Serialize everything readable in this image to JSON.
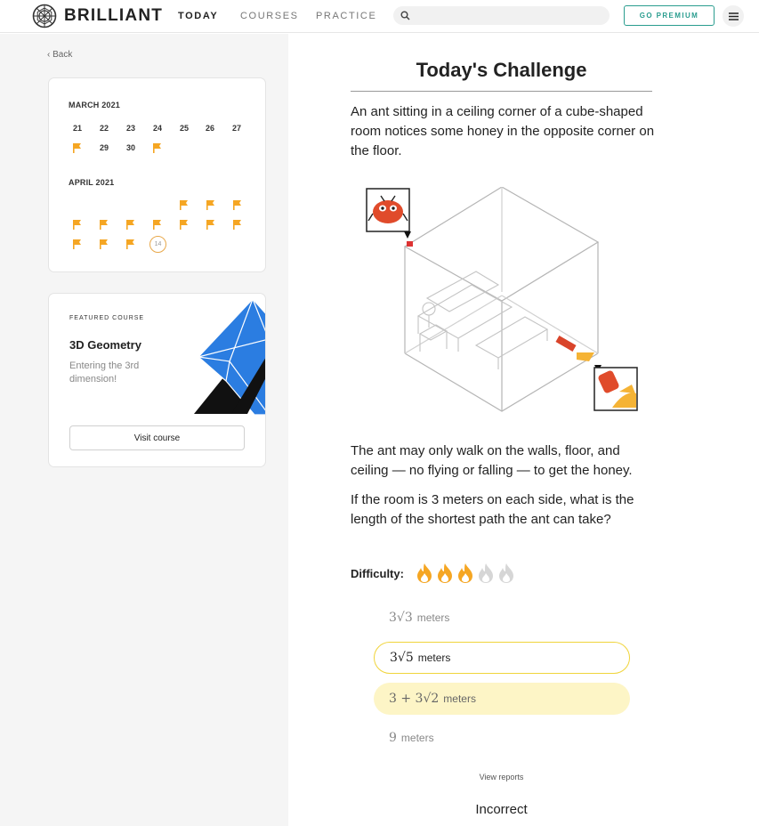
{
  "header": {
    "brand": "BRILLIANT",
    "nav": [
      "TODAY",
      "COURSES",
      "PRACTICE"
    ],
    "active_nav": "TODAY",
    "search_placeholder": "",
    "premium_label": "GO PREMIUM",
    "accent_color": "#2a9d8f"
  },
  "sidebar": {
    "back_label": "Back",
    "calendar": {
      "march_label": "MARCH 2021",
      "march_days": [
        "21",
        "22",
        "23",
        "24",
        "25",
        "26",
        "27",
        "29",
        "30"
      ],
      "april_label": "APRIL 2021",
      "today": "14",
      "flag_color": "#f5a623"
    },
    "featured": {
      "label": "FEATURED COURSE",
      "title": "3D Geometry",
      "description": "Entering the 3rd dimension!",
      "button": "Visit course"
    }
  },
  "challenge": {
    "title": "Today's Challenge",
    "intro": "An ant sitting in a ceiling corner of a cube-shaped room notices some honey in the opposite corner on the floor.",
    "rule": "The ant may only walk on the walls, floor, and ceiling — no flying or falling — to get the honey.",
    "question": "If the room is 3 meters on each side, what is the length of the shortest path the ant can take?",
    "difficulty_label": "Difficulty:",
    "difficulty_level": 3,
    "difficulty_max": 5,
    "options": [
      {
        "math": "3√3",
        "unit": "meters",
        "state": "normal"
      },
      {
        "math": "3√5",
        "unit": "meters",
        "state": "selected"
      },
      {
        "math": "3 + 3√2",
        "unit": "meters",
        "state": "correct"
      },
      {
        "math": "9",
        "unit": "meters",
        "state": "normal"
      }
    ],
    "view_reports": "View reports",
    "result": "Incorrect"
  }
}
